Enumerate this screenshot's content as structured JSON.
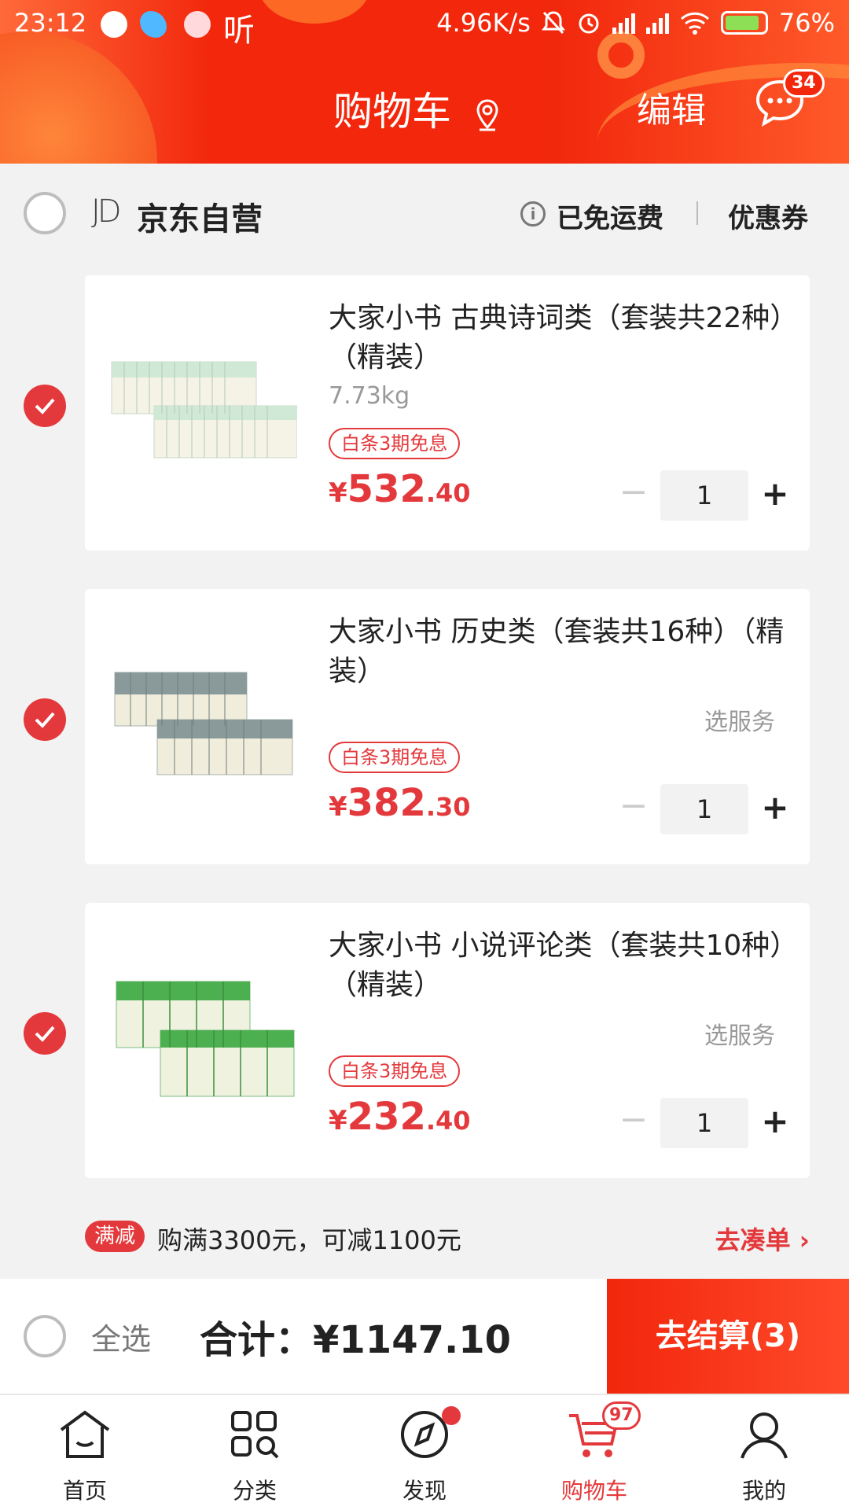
{
  "status_bar": {
    "time": "23:12",
    "listen_label": "听",
    "net_speed": "4.96K/s",
    "battery": "76%"
  },
  "header": {
    "title": "购物车",
    "edit_label": "编辑",
    "message_count": "34",
    "icons": [
      "location-pin-icon",
      "message-icon"
    ]
  },
  "store": {
    "logo_text": "JD",
    "name": "京东自营",
    "shipping": "已免运费",
    "coupon": "优惠券"
  },
  "items": [
    {
      "name": "大家小书 古典诗词类（套装共22种）（精装）",
      "weight": "7.73kg",
      "service": "",
      "tag": "白条3期免息",
      "price_symbol": "¥",
      "price_int": "532",
      "price_dec": ".40",
      "quantity": "1",
      "checked": true,
      "minus": "−",
      "plus": "+"
    },
    {
      "name": "大家小书 历史类（套装共16种）（精装）",
      "weight": "",
      "service": "选服务",
      "tag": "白条3期免息",
      "price_symbol": "¥",
      "price_int": "382",
      "price_dec": ".30",
      "quantity": "1",
      "checked": true,
      "minus": "−",
      "plus": "+"
    },
    {
      "name": "大家小书 小说评论类（套装共10种）（精装）",
      "weight": "",
      "service": "选服务",
      "tag": "白条3期免息",
      "price_symbol": "¥",
      "price_int": "232",
      "price_dec": ".40",
      "quantity": "1",
      "checked": true,
      "minus": "−",
      "plus": "+"
    }
  ],
  "promo": {
    "badge": "满减",
    "text": "购满3300元，可减1100元",
    "action": "去凑单 ›"
  },
  "checkout": {
    "select_all": "全选",
    "total": "合计：¥1147.10",
    "pay_button": "去结算(3)"
  },
  "tabbar": {
    "tabs": [
      {
        "label": "首页",
        "icon": "home-icon"
      },
      {
        "label": "分类",
        "icon": "category-icon"
      },
      {
        "label": "发现",
        "icon": "discover-icon"
      },
      {
        "label": "购物车",
        "icon": "cart-icon",
        "badge": "97"
      },
      {
        "label": "我的",
        "icon": "profile-icon"
      }
    ]
  },
  "colors": {
    "brand_red": "#e4393c",
    "header_red": "#f2270c",
    "book_mint": "#cfe9d6",
    "book_slate": "#8a9a9a",
    "book_green": "#4caf50"
  }
}
